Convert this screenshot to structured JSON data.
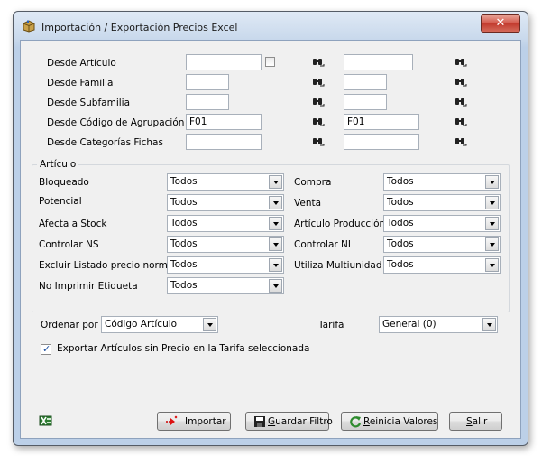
{
  "window": {
    "title": "Importación / Exportación Precios Excel",
    "close_glyph": "✕"
  },
  "desde": [
    {
      "label": "Desde Artículo",
      "from": "",
      "to": ""
    },
    {
      "label": "Desde Familia",
      "from": "",
      "to": ""
    },
    {
      "label": "Desde Subfamilia",
      "from": "",
      "to": ""
    },
    {
      "label": "Desde Código de Agrupación",
      "from": "F01",
      "to": "F01"
    },
    {
      "label": "Desde Categorías Fichas",
      "from": "",
      "to": ""
    }
  ],
  "articulo_group": {
    "title": "Artículo",
    "left": [
      {
        "label": "Bloqueado",
        "value": "Todos"
      },
      {
        "label": "Potencial",
        "value": "Todos"
      },
      {
        "label": "Afecta a Stock",
        "value": "Todos"
      },
      {
        "label": "Controlar NS",
        "value": "Todos"
      },
      {
        "label": "Excluir Listado precio normal",
        "value": "Todos"
      },
      {
        "label": "No Imprimir Etiqueta",
        "value": "Todos"
      }
    ],
    "right": [
      {
        "label": "Compra",
        "value": "Todos"
      },
      {
        "label": "Venta",
        "value": "Todos"
      },
      {
        "label": "Artículo Producción",
        "value": "Todos"
      },
      {
        "label": "Controlar NL",
        "value": "Todos"
      },
      {
        "label": "Utiliza Multiunidad",
        "value": "Todos"
      }
    ]
  },
  "ordenar": {
    "label": "Ordenar por",
    "value": "Código Artículo"
  },
  "tarifa": {
    "label": "Tarifa",
    "value": "General (0)"
  },
  "export_checkbox": {
    "label": "Exportar Artículos sin Precio en la Tarifa seleccionada",
    "checked": true,
    "mark": "✓"
  },
  "buttons": {
    "importar": "Importar",
    "guardar_u": "G",
    "guardar_rest": "uardar Filtro",
    "reinicia_u": "R",
    "reinicia_rest": "einicia Valores",
    "salir_u": "S",
    "salir_rest": "alir"
  },
  "icons": {
    "title": "package-icon",
    "search": "binoculars-icon",
    "excel": "excel-icon"
  }
}
